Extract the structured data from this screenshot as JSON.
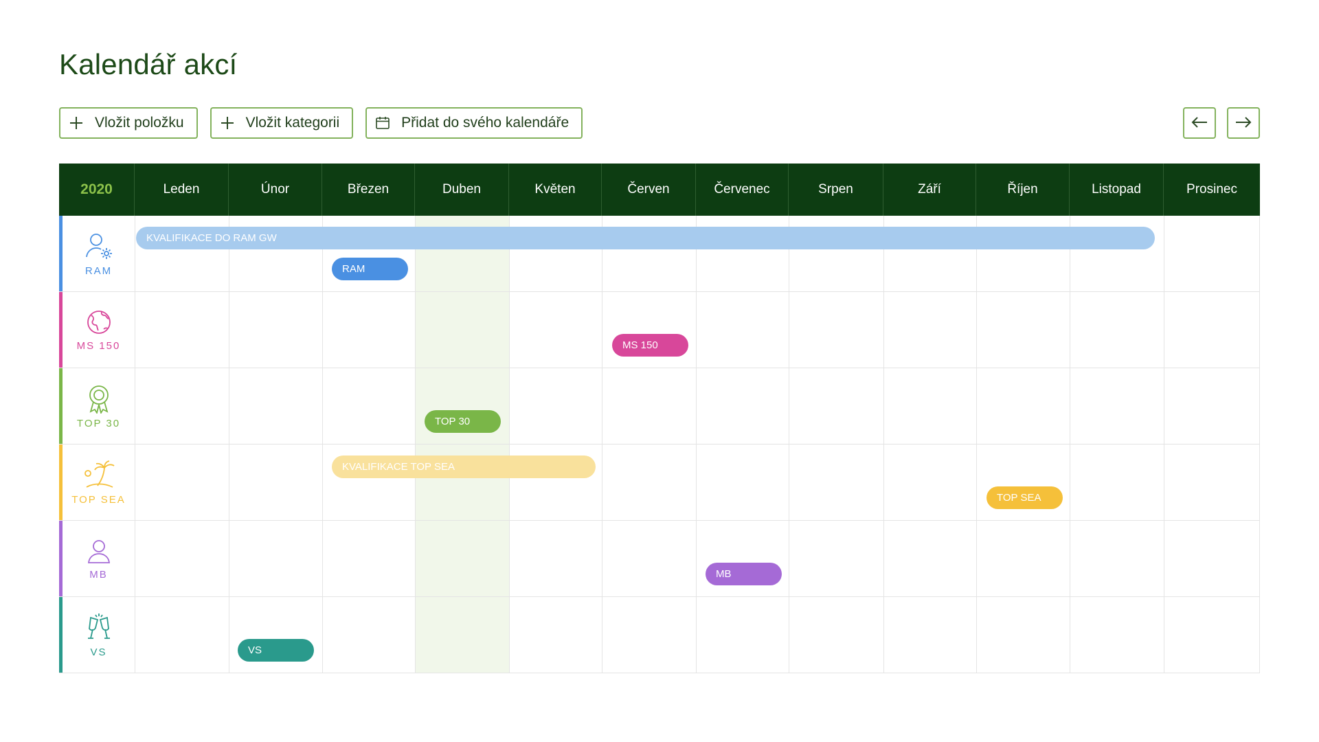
{
  "page": {
    "title": "Kalendář akcí"
  },
  "toolbar": {
    "add_item_label": "Vložit položku",
    "add_category_label": "Vložit kategorii",
    "add_to_calendar_label": "Přidat do svého kalendáře"
  },
  "calendar": {
    "year": "2020",
    "months": [
      "Leden",
      "Únor",
      "Březen",
      "Duben",
      "Květen",
      "Červen",
      "Červenec",
      "Srpen",
      "Září",
      "Říjen",
      "Listopad",
      "Prosinec"
    ],
    "highlighted_month": "Duben",
    "categories": [
      {
        "label": "RAM",
        "icon": "user-gear-icon",
        "color": "#4a90e2"
      },
      {
        "label": "MS 150",
        "icon": "globe-icon",
        "color": "#d8479a"
      },
      {
        "label": "TOP 30",
        "icon": "award-ribbon-icon",
        "color": "#7ab648"
      },
      {
        "label": "TOP SEA",
        "icon": "palm-island-icon",
        "color": "#f5c03a"
      },
      {
        "label": "MB",
        "icon": "user-icon",
        "color": "#a56ad6"
      },
      {
        "label": "VS",
        "icon": "champagne-glasses-icon",
        "color": "#2a9a8c"
      }
    ],
    "events": [
      {
        "label": "KVALIFIKACE DO RAM GW",
        "color": "#a7cbee"
      },
      {
        "label": "RAM",
        "color": "#4a90e2"
      },
      {
        "label": "MS 150",
        "color": "#d8479a"
      },
      {
        "label": "TOP 30",
        "color": "#7ab648"
      },
      {
        "label": "KVALIFIKACE TOP SEA",
        "color": "#f9e19c"
      },
      {
        "label": "TOP SEA",
        "color": "#f5c03a"
      },
      {
        "label": "MB",
        "color": "#a56ad6"
      },
      {
        "label": "VS",
        "color": "#2a9a8c"
      }
    ]
  }
}
